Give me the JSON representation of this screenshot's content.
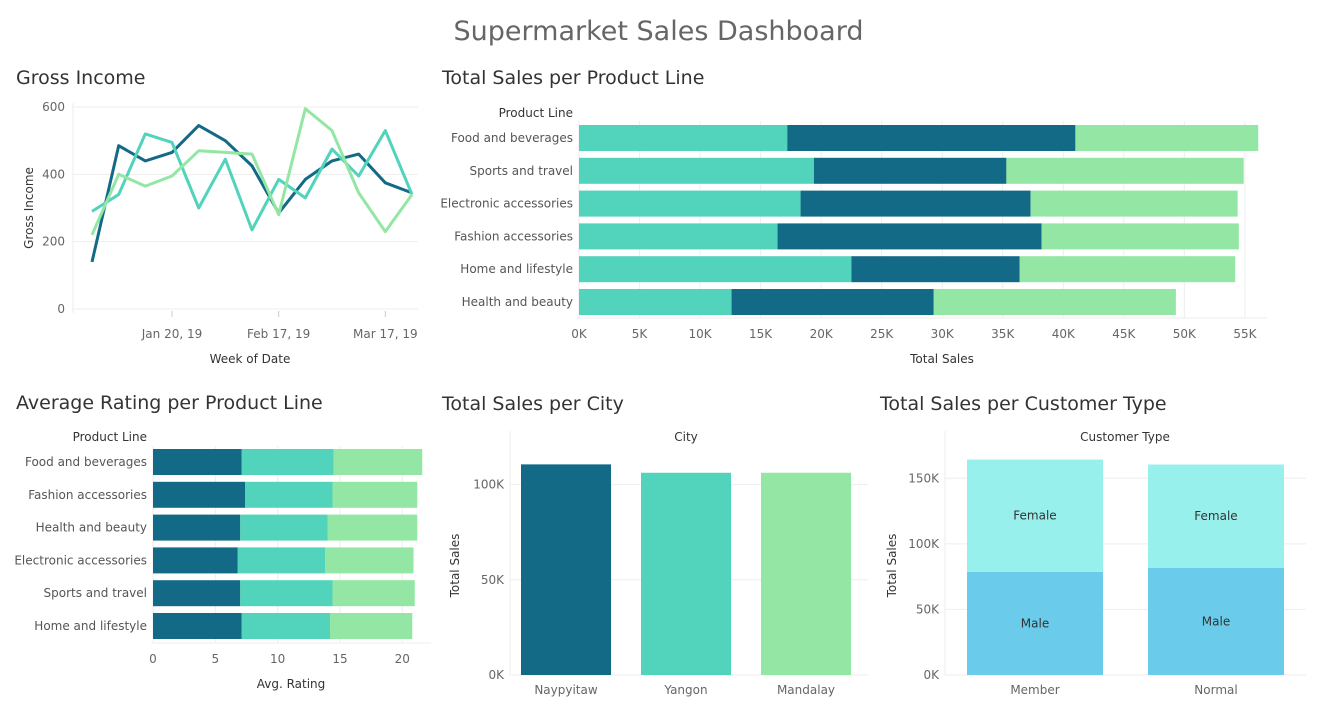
{
  "dashboard": {
    "title": "Supermarket Sales Dashboard"
  },
  "colors": {
    "dark": "#136a87",
    "teal": "#52d3bb",
    "green": "#94e6a5",
    "female": "#98f0ed",
    "male": "#6accea",
    "grid": "#eeeeee",
    "axis": "#666666"
  },
  "chart_data": [
    {
      "id": "gross-income",
      "type": "line",
      "title": "Gross Income",
      "xlabel": "Week of Date",
      "ylabel": "Gross Income",
      "x_ticks": [
        "Jan 20, 19",
        "Feb 17, 19",
        "Mar 17, 19"
      ],
      "y_ticks": [
        "0",
        "200",
        "400",
        "600"
      ],
      "ylim": [
        0,
        600
      ],
      "x": [
        "Jan 1, 19",
        "Jan 6, 19",
        "Jan 13, 19",
        "Jan 20, 19",
        "Jan 27, 19",
        "Feb 3, 19",
        "Feb 10, 19",
        "Feb 17, 19",
        "Feb 24, 19",
        "Mar 3, 19",
        "Mar 10, 19",
        "Mar 17, 19",
        "Mar 24, 19"
      ],
      "series": [
        {
          "color": "#136a87",
          "values": [
            140,
            485,
            440,
            465,
            545,
            500,
            425,
            285,
            385,
            440,
            460,
            375,
            345
          ]
        },
        {
          "color": "#52d3bb",
          "values": [
            290,
            340,
            520,
            495,
            300,
            445,
            235,
            385,
            330,
            475,
            395,
            530,
            340
          ]
        },
        {
          "color": "#94e6a5",
          "values": [
            220,
            400,
            365,
            395,
            470,
            465,
            460,
            280,
            595,
            530,
            345,
            230,
            340
          ]
        }
      ]
    },
    {
      "id": "product-line-sales",
      "type": "bar",
      "orientation": "horizontal",
      "stacked": true,
      "title": "Total Sales per Product Line",
      "category_header": "Product Line",
      "xlabel": "Total Sales",
      "x_ticks": [
        "0K",
        "5K",
        "10K",
        "15K",
        "20K",
        "25K",
        "30K",
        "35K",
        "40K",
        "45K",
        "50K",
        "55K"
      ],
      "xlim": [
        0,
        56000
      ],
      "categories": [
        "Food and beverages",
        "Sports and travel",
        "Electronic accessories",
        "Fashion accessories",
        "Home and lifestyle",
        "Health and beauty"
      ],
      "series": [
        {
          "color": "#52d3bb",
          "values": [
            17200,
            19400,
            18300,
            16400,
            22500,
            12600
          ]
        },
        {
          "color": "#136a87",
          "values": [
            23800,
            15900,
            19000,
            21800,
            13900,
            16700
          ]
        },
        {
          "color": "#94e6a5",
          "values": [
            15100,
            19600,
            17100,
            16300,
            17800,
            20000
          ]
        }
      ]
    },
    {
      "id": "avg-rating",
      "type": "bar",
      "orientation": "horizontal",
      "stacked": true,
      "title": "Average Rating per Product Line",
      "category_header": "Product Line",
      "xlabel": "Avg. Rating",
      "x_ticks": [
        "0",
        "5",
        "10",
        "15",
        "20"
      ],
      "xlim": [
        0,
        21.5
      ],
      "categories": [
        "Food and beverages",
        "Fashion accessories",
        "Health and beauty",
        "Electronic accessories",
        "Sports and travel",
        "Home and lifestyle"
      ],
      "series": [
        {
          "color": "#136a87",
          "values": [
            7.1,
            7.4,
            7.0,
            6.8,
            7.0,
            7.1
          ]
        },
        {
          "color": "#52d3bb",
          "values": [
            7.4,
            7.0,
            7.0,
            7.0,
            7.4,
            7.1
          ]
        },
        {
          "color": "#94e6a5",
          "values": [
            7.1,
            6.8,
            7.2,
            7.1,
            6.6,
            6.6
          ]
        }
      ]
    },
    {
      "id": "city-sales",
      "type": "bar",
      "title": "Total Sales per City",
      "category_header": "City",
      "ylabel": "Total Sales",
      "y_ticks": [
        "0K",
        "50K",
        "100K"
      ],
      "ylim": [
        0,
        115000
      ],
      "categories": [
        "Naypyitaw",
        "Yangon",
        "Mandalay"
      ],
      "colors": [
        "#136a87",
        "#52d3bb",
        "#94e6a5"
      ],
      "values": [
        110600,
        106200,
        106200
      ]
    },
    {
      "id": "customer-type-sales",
      "type": "bar",
      "stacked": true,
      "title": "Total Sales per Customer Type",
      "category_header": "Customer Type",
      "ylabel": "Total Sales",
      "y_ticks": [
        "0K",
        "50K",
        "100K",
        "150K"
      ],
      "ylim": [
        0,
        167000
      ],
      "categories": [
        "Member",
        "Normal"
      ],
      "series": [
        {
          "name": "Male",
          "color": "#6accea",
          "values": [
            78600,
            81800
          ]
        },
        {
          "name": "Female",
          "color": "#98f0ed",
          "values": [
            85700,
            78700
          ]
        }
      ]
    }
  ]
}
